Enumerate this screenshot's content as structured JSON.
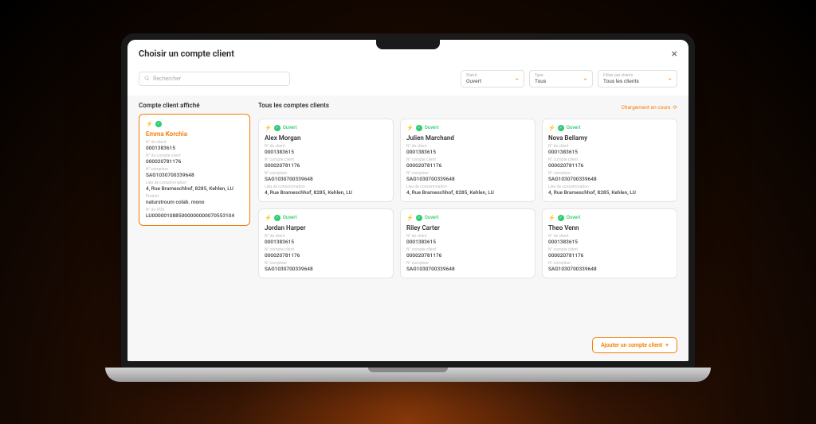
{
  "modal": {
    "title": "Choisir un compte client"
  },
  "search": {
    "placeholder": "Rechercher"
  },
  "filters": {
    "status": {
      "label": "Statut",
      "value": "Ouvert"
    },
    "type": {
      "label": "Type",
      "value": "Tous"
    },
    "clientFilter": {
      "label": "Filtrer par clients",
      "value": "Tous les clients"
    }
  },
  "sections": {
    "displayed": "Compte client affiché",
    "all": "Tous les comptes clients",
    "loading": "Chargement en cours"
  },
  "labels": {
    "clientNo": "N° de client",
    "accountNo": "N° du compte client",
    "meterNo": "N° compteur",
    "location": "Lieu de consommation",
    "product": "Produit",
    "pod": "N° du POD",
    "status": "Ouvert",
    "accountNoShort": "N° compte client"
  },
  "selected": {
    "name": "Emma Korchia",
    "clientNo": "0001383615",
    "accountNo": "000020781176",
    "meterNo": "SAG1030700339648",
    "location": "4, Rue Brameschhof, 8285, Kehlen, LU",
    "product": "naturstroum colab. mono",
    "pod": "LU0000010885000000000070553104"
  },
  "accounts": [
    {
      "name": "Alex Morgan",
      "clientNo": "0001383615",
      "accountNo": "000020781176",
      "meterNo": "SAG1030700339648",
      "location": "4, Rue Brameschhof, 8285, Kehlen, LU"
    },
    {
      "name": "Julien Marchand",
      "clientNo": "0001383615",
      "accountNo": "000020781176",
      "meterNo": "SAG1030700339648",
      "location": "4, Rue Brameschhof, 8285, Kehlen, LU"
    },
    {
      "name": "Nova Bellamy",
      "clientNo": "0001383615",
      "accountNo": "000020781176",
      "meterNo": "SAG1030700339648",
      "location": "4, Rue Brameschhof, 8285, Kehlen, LU"
    },
    {
      "name": "Jordan Harper",
      "clientNo": "0001383615",
      "accountNo": "000020781176",
      "meterNo": "SAG1030700339648"
    },
    {
      "name": "Riley Carter",
      "clientNo": "0001383615",
      "accountNo": "000020781176",
      "meterNo": "SAG1030700339648"
    },
    {
      "name": "Theo Venn",
      "clientNo": "0001383615",
      "accountNo": "000020781176",
      "meterNo": "SAG1030700339648"
    }
  ],
  "footerButton": "Ajouter un compte client"
}
